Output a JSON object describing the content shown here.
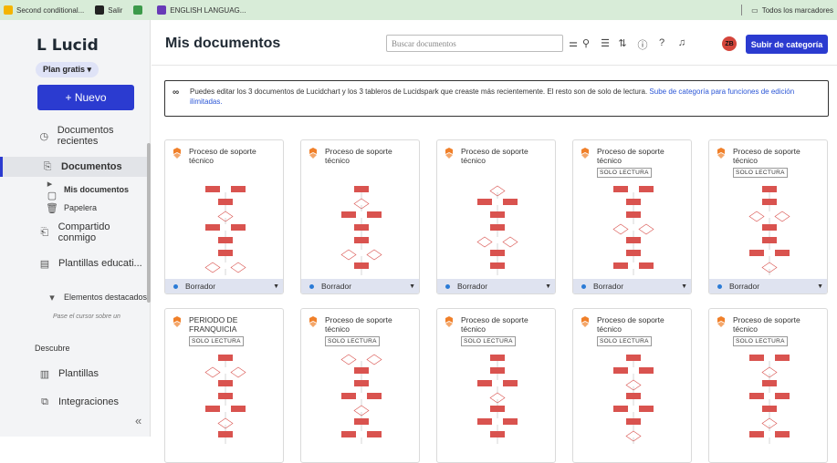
{
  "bookmarks": [
    {
      "label": "Second conditional...",
      "icon": "google-slides-icon",
      "color": "#f4b400"
    },
    {
      "label": "Salir",
      "icon": "github-icon",
      "color": "#222"
    },
    {
      "label": "",
      "icon": "extension-icon",
      "color": "#3c9a4a"
    },
    {
      "label": "ENGLISH LANGUAG...",
      "icon": "forms-icon",
      "color": "#673ab7"
    }
  ],
  "bookmarks_right": "Todos los marcadores",
  "sidebar": {
    "logo": "L Lucid",
    "plan": "Plan gratis ▾",
    "new_button": "+ Nuevo",
    "items": [
      {
        "label": "Documentos recientes",
        "icon": "clock-icon",
        "glyph": "◷"
      },
      {
        "label": "Documentos",
        "icon": "documents-icon",
        "glyph": "⎘",
        "bold": true
      },
      {
        "label": "Mis documentos",
        "icon": "document-icon",
        "glyph": "▸ ▢",
        "bold": true
      },
      {
        "label": "Papelera",
        "icon": "trash-icon",
        "glyph": "🗑"
      },
      {
        "label": "Compartido conmigo",
        "icon": "shared-icon",
        "glyph": "⎗"
      },
      {
        "label": "Plantillas educati...",
        "icon": "template-icon",
        "glyph": "▤"
      },
      {
        "label": "Elementos destacados",
        "icon": "chevron-down-icon",
        "glyph": "▾"
      },
      {
        "label": "Pase el cursor sobre un",
        "icon": "",
        "glyph": ""
      },
      {
        "label": "Descubre",
        "icon": "",
        "glyph": ""
      },
      {
        "label": "Plantillas",
        "icon": "templates-icon",
        "glyph": "▥"
      },
      {
        "label": "Integraciones",
        "icon": "integrations-icon",
        "glyph": "⧉"
      }
    ],
    "collapse": "«"
  },
  "header": {
    "title": "Mis documentos",
    "search_placeholder": "Buscar documentos",
    "avatar": "ZB",
    "upgrade": "Subir de categoría"
  },
  "notice": {
    "text": "Puedes editar los 3 documentos de Lucidchart y los 3 tableros de Lucidspark que creaste más recientemente. El resto son de solo de lectura.",
    "link": "Sube de categoría para funciones de edición ilimitadas."
  },
  "cards": [
    {
      "title": "Proceso de soporte técnico",
      "readonly": "",
      "status": "Borrador"
    },
    {
      "title": "Proceso de soporte técnico",
      "readonly": "",
      "status": "Borrador"
    },
    {
      "title": "Proceso de soporte técnico",
      "readonly": "",
      "status": "Borrador"
    },
    {
      "title": "Proceso de soporte técnico",
      "readonly": "SOLO LECTURA",
      "status": "Borrador"
    },
    {
      "title": "Proceso de soporte técnico",
      "readonly": "SOLO LECTURA",
      "status": "Borrador"
    },
    {
      "title": "PERIODO DE FRANQUICIA",
      "readonly": "SOLO LECTURA",
      "status": ""
    },
    {
      "title": "Proceso de soporte técnico",
      "readonly": "SOLO LECTURA",
      "status": ""
    },
    {
      "title": "Proceso de soporte técnico",
      "readonly": "SOLO LECTURA",
      "status": ""
    },
    {
      "title": "Proceso de soporte técnico",
      "readonly": "SOLO LECTURA",
      "status": ""
    },
    {
      "title": "Proceso de soporte técnico",
      "readonly": "SOLO LECTURA",
      "status": ""
    }
  ],
  "colors": {
    "accent": "#2b3bd0",
    "flow": "#d9534f",
    "brand": "#f0802a"
  }
}
